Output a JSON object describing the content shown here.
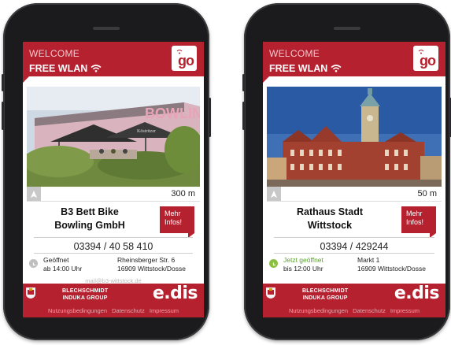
{
  "phones": [
    {
      "header": {
        "welcome": "WELCOME",
        "free_wlan": "FREE WLAN",
        "logo_text": "go"
      },
      "distance": "300 m",
      "poi_name": "B3 Bett Bike\nBowling GmbH",
      "poi_line1": "B3 Bett Bike",
      "poi_line2": "Bowling GmbH",
      "more_info_line1": "Mehr",
      "more_info_line2": "Infos!",
      "phone": "03394 / 40 58 410",
      "status": "Geöffnet",
      "hours": "ab 14:00 Uhr",
      "address_line1": "Rheinsberger Str. 6",
      "address_line2": "16909 Wittstock/Dosse",
      "email": "mail@b3-wittstock.de",
      "sponsor_line1": "BLECHSCHMIDT",
      "sponsor_line2": "INDUKA GROUP",
      "brand": "e.dis",
      "footer_links": [
        "Nutzungsbedingungen",
        "Datenschutz",
        "Impressum"
      ]
    },
    {
      "header": {
        "welcome": "WELCOME",
        "free_wlan": "FREE WLAN",
        "logo_text": "go"
      },
      "distance": "50 m",
      "poi_line1": "Rathaus Stadt",
      "poi_line2": "Wittstock",
      "more_info_line1": "Mehr",
      "more_info_line2": "Infos!",
      "phone": "03394 / 429244",
      "status": "Jetzt geöffnet",
      "hours": "bis 12:00 Uhr",
      "address_line1": "Markt 1",
      "address_line2": "16909 Wittstock/Dosse",
      "email": "",
      "sponsor_line1": "BLECHSCHMIDT",
      "sponsor_line2": "INDUKA GROUP",
      "brand": "e.dis",
      "footer_links": [
        "Nutzungsbedingungen",
        "Datenschutz",
        "Impressum"
      ]
    }
  ],
  "colors": {
    "brand_red": "#b62130",
    "open_green": "#5aa02c"
  },
  "icons": [
    "wifi-icon",
    "go-logo-icon",
    "navigation-arrow-icon",
    "clock-icon",
    "coat-of-arms-icon"
  ]
}
